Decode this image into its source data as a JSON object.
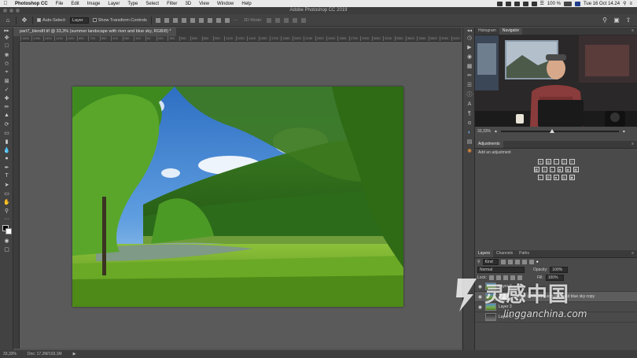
{
  "menubar": {
    "app_name": "Photoshop CC",
    "items": [
      "File",
      "Edit",
      "Image",
      "Layer",
      "Type",
      "Select",
      "Filter",
      "3D",
      "View",
      "Window",
      "Help"
    ],
    "battery": "100 %",
    "clock": "Tue 16 Oct 14.24"
  },
  "window": {
    "title": "Adobe Photoshop CC 2019"
  },
  "options_bar": {
    "auto_select_label": "Auto-Select:",
    "auto_select_value": "Layer",
    "transform_label": "Show Transform Controls",
    "mode_label": "3D Mode:"
  },
  "document": {
    "tab_title": "part7_blendIf.tif @ 33,3% (summer landscape with river and blue sky, RGB/8) *",
    "ruler_ticks": [
      "1600",
      "1450",
      "1300",
      "1150",
      "1000",
      "850",
      "700",
      "550",
      "400",
      "250",
      "100",
      "50",
      "200",
      "350",
      "500",
      "650",
      "800",
      "950",
      "1100",
      "1250",
      "1400",
      "1550",
      "1700",
      "1850",
      "2000",
      "2150",
      "2300",
      "2450",
      "2600",
      "2750",
      "2900",
      "3050",
      "3200",
      "3350",
      "3500",
      "3650",
      "3800",
      "3950",
      "4100"
    ]
  },
  "status": {
    "zoom": "33,33%",
    "doc": "Doc: 17,2M/103,1M"
  },
  "panels": {
    "nav_tabs": [
      "Histogram",
      "Navigator"
    ],
    "nav_zoom": "33,33%",
    "adjustments_title": "Adjustments",
    "adjustments_hint": "Add an adjustment",
    "layers_tabs": [
      "Layers",
      "Channels",
      "Paths"
    ],
    "kind_label": "Kind",
    "blend_mode": "Normal",
    "opacity_label": "Opacity:",
    "opacity_value": "100%",
    "lock_label": "Lock:",
    "fill_label": "Fill:",
    "fill_value": "100%",
    "layers": [
      {
        "name": "Layer 2",
        "visible": true,
        "selected": false
      },
      {
        "name": "summer landscape with river and blue sky copy",
        "visible": true,
        "selected": true
      },
      {
        "name": "Layer 3",
        "visible": true,
        "selected": false
      },
      {
        "name": "Layer 1",
        "visible": false,
        "selected": false
      }
    ]
  },
  "watermark": {
    "cn": "灵感中国",
    "en": "lingganchina.com"
  },
  "icons": {
    "tools": [
      "move-icon",
      "marquee-icon",
      "lasso-icon",
      "quick-select-icon",
      "crop-icon",
      "frame-icon",
      "eyedropper-icon",
      "healing-icon",
      "brush-icon",
      "stamp-icon",
      "history-brush-icon",
      "eraser-icon",
      "gradient-icon",
      "blur-icon",
      "dodge-icon",
      "pen-icon",
      "type-icon",
      "path-select-icon",
      "rectangle-icon",
      "hand-icon",
      "zoom-icon",
      "more-icon",
      "color-swatch-icon",
      "quick-mask-icon",
      "screen-mode-icon"
    ],
    "dock": [
      "play-icon",
      "brush-preset-icon",
      "clone-source-icon",
      "history-icon",
      "character-icon",
      "paragraph-icon",
      "glyphs-icon",
      "adjustments-icon",
      "libraries-icon",
      "swatches-icon"
    ]
  }
}
